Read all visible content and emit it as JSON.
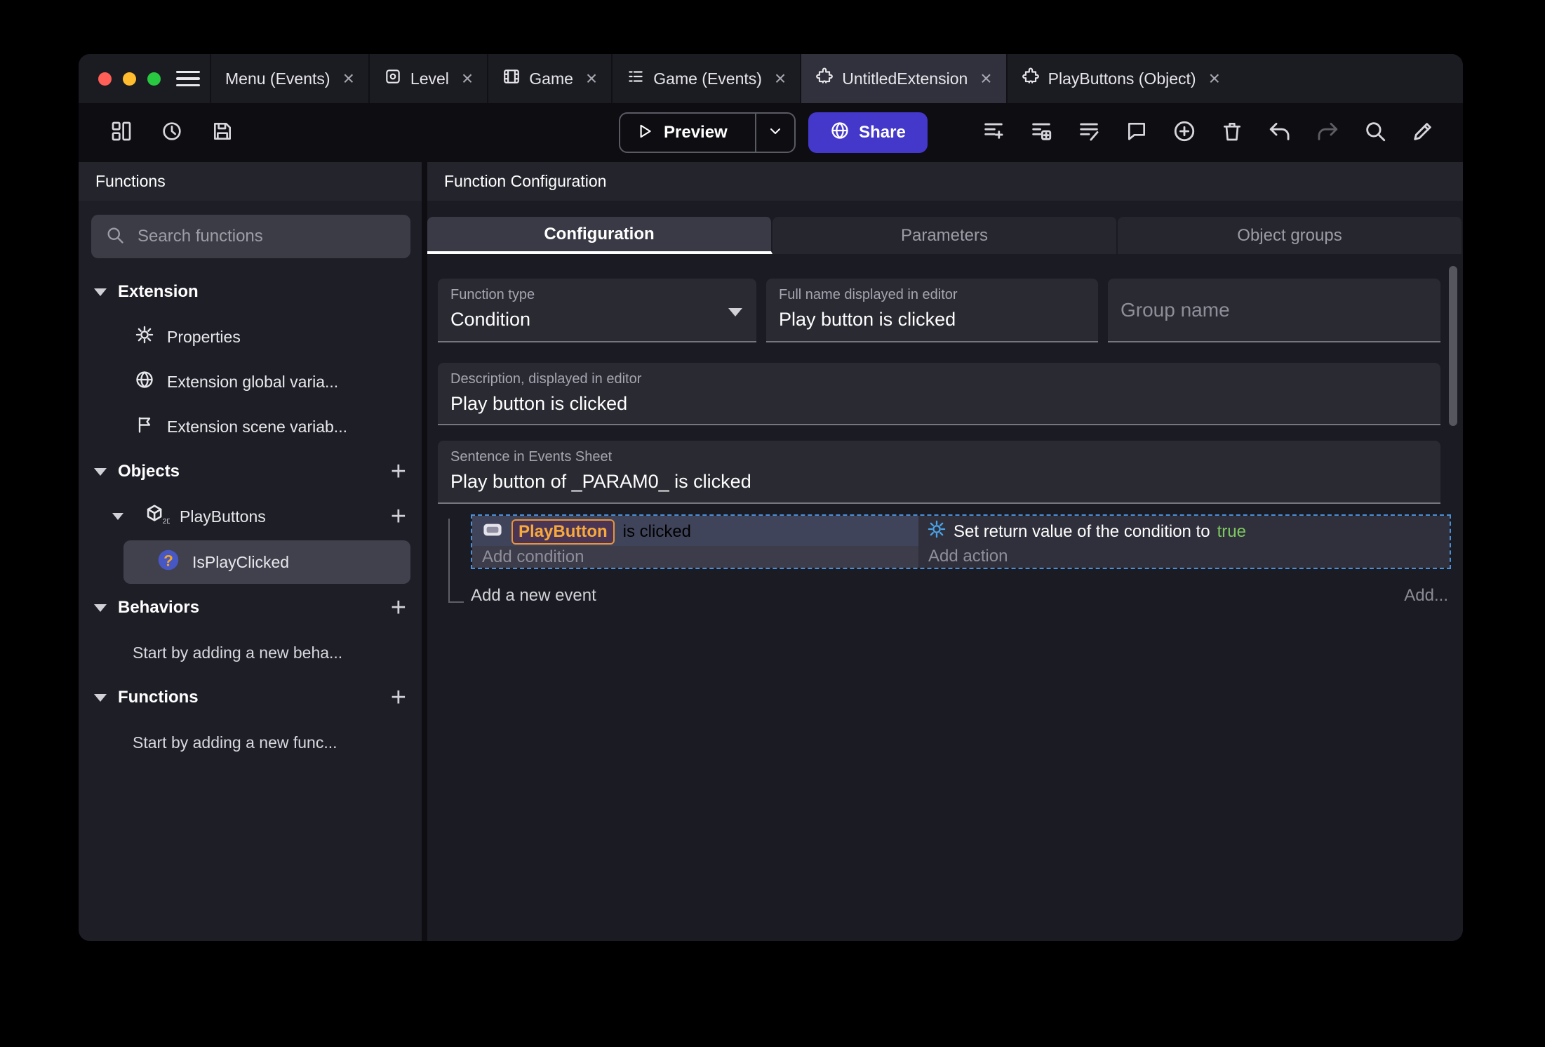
{
  "colors": {
    "share_button": "#4438cb",
    "event_selection_border": "#4a8fd8",
    "object_highlight": "#f7a93d",
    "boolean_true_green": "#7ec860",
    "traffic_red": "#ff5f57",
    "traffic_yellow": "#febc2e",
    "traffic_green": "#28c840"
  },
  "titlebar": {
    "close_glyph": "×",
    "tabs": [
      {
        "label": "Menu (Events)"
      },
      {
        "label": "Level"
      },
      {
        "label": "Game"
      },
      {
        "label": "Game (Events)"
      },
      {
        "label": "UntitledExtension"
      },
      {
        "label": "PlayButtons (Object)"
      }
    ]
  },
  "toolbar": {
    "preview_label": "Preview",
    "share_label": "Share"
  },
  "sidebar": {
    "header": "Functions",
    "search_placeholder": "Search functions",
    "plus_glyph": "+",
    "extension": {
      "label": "Extension",
      "items": [
        {
          "label": "Properties"
        },
        {
          "label": "Extension global varia..."
        },
        {
          "label": "Extension scene variab..."
        }
      ]
    },
    "objects": {
      "label": "Objects",
      "object_label": "PlayButtons",
      "function_label": "IsPlayClicked",
      "object_badge": "2D"
    },
    "behaviors": {
      "label": "Behaviors",
      "empty": "Start by adding a new beha..."
    },
    "functions": {
      "label": "Functions",
      "empty": "Start by adding a new func..."
    }
  },
  "main": {
    "header": "Function Configuration",
    "tabs": [
      {
        "label": "Configuration"
      },
      {
        "label": "Parameters"
      },
      {
        "label": "Object groups"
      }
    ],
    "fields": {
      "function_type_label": "Function type",
      "function_type_value": "Condition",
      "full_name_label": "Full name displayed in editor",
      "full_name_value": "Play button is clicked",
      "group_name_placeholder": "Group name",
      "description_label": "Description, displayed in editor",
      "description_value": "Play button is clicked",
      "sentence_label": "Sentence in Events Sheet",
      "sentence_value": "Play button of _PARAM0_ is clicked"
    },
    "events": {
      "condition_object": "PlayButton",
      "condition_text": "is clicked",
      "add_condition": "Add condition",
      "action_prefix": "Set return value of the condition to",
      "action_value": "true",
      "add_action": "Add action",
      "add_new_event": "Add a new event",
      "add_more": "Add..."
    }
  }
}
